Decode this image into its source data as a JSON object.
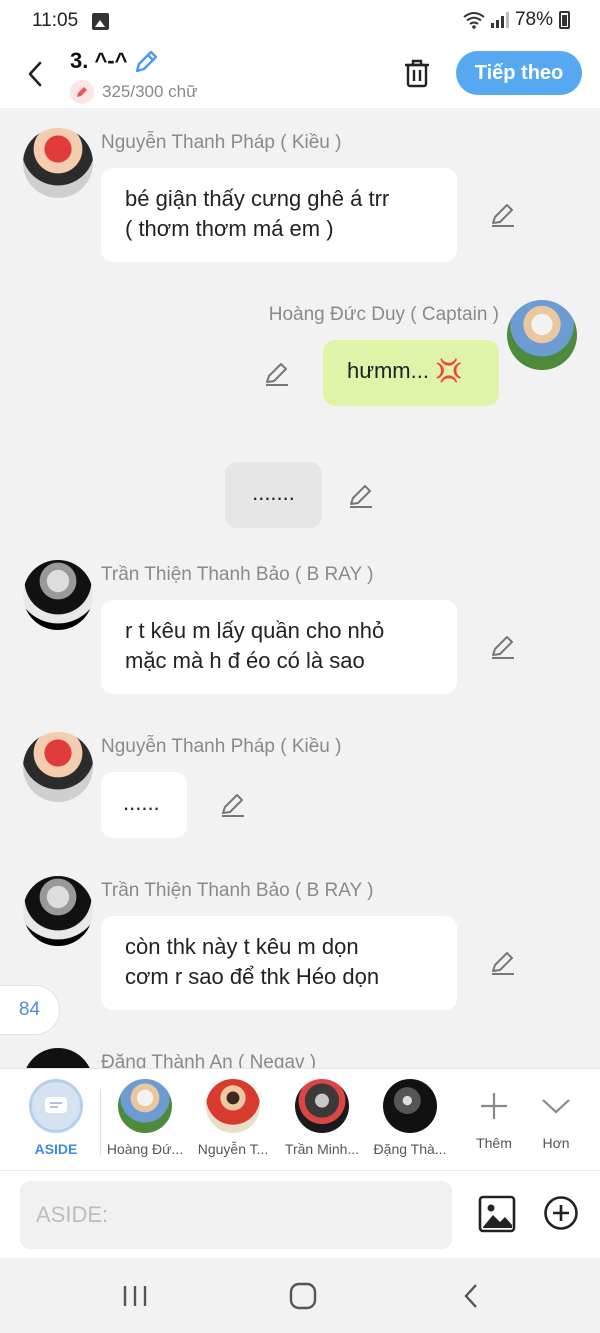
{
  "status": {
    "time": "11:05",
    "battery": "78%"
  },
  "header": {
    "title": "3. ^-^",
    "counter": "325/300 chữ",
    "next_label": "Tiếp theo"
  },
  "messages": [
    {
      "author": "Nguyễn Thanh Pháp ( Kiều )",
      "text": "bé giận thấy cưng ghê á trr\n( thơm thơm má em )"
    },
    {
      "author": "Hoàng Đức Duy ( Captain )",
      "text": "hưmm... 💢"
    },
    {
      "text": "......."
    },
    {
      "author": "Trần Thiện Thanh Bảo ( B RAY )",
      "text": "r t kêu m lấy quần cho nhỏ\nmặc mà h đ  éo có là sao"
    },
    {
      "author": "Nguyễn Thanh Pháp ( Kiều )",
      "text": "......"
    },
    {
      "author": "Trần Thiện Thanh Bảo ( B RAY )",
      "text": "còn thk này t kêu m dọn\ncơm r sao để thk Héo dọn"
    },
    {
      "author": "Đặng Thành An ( Negav )"
    }
  ],
  "scroll_badge": "84",
  "characters": [
    {
      "label": "ASIDE"
    },
    {
      "label": "Hoàng Đứ..."
    },
    {
      "label": "Nguyễn T..."
    },
    {
      "label": "Trần Minh..."
    },
    {
      "label": "Đặng Thà..."
    },
    {
      "label": "Thêm"
    },
    {
      "label": "Hơn"
    }
  ],
  "input": {
    "placeholder": "ASIDE:"
  },
  "icons": {
    "back": "chevron-left-icon",
    "edit": "pencil-icon",
    "trash": "trash-icon",
    "image": "image-icon",
    "add": "plus-circle-icon"
  },
  "colors": {
    "accent": "#56a9f0",
    "my_bubble": "#dff4a8",
    "aside": "#3e8ddd"
  }
}
